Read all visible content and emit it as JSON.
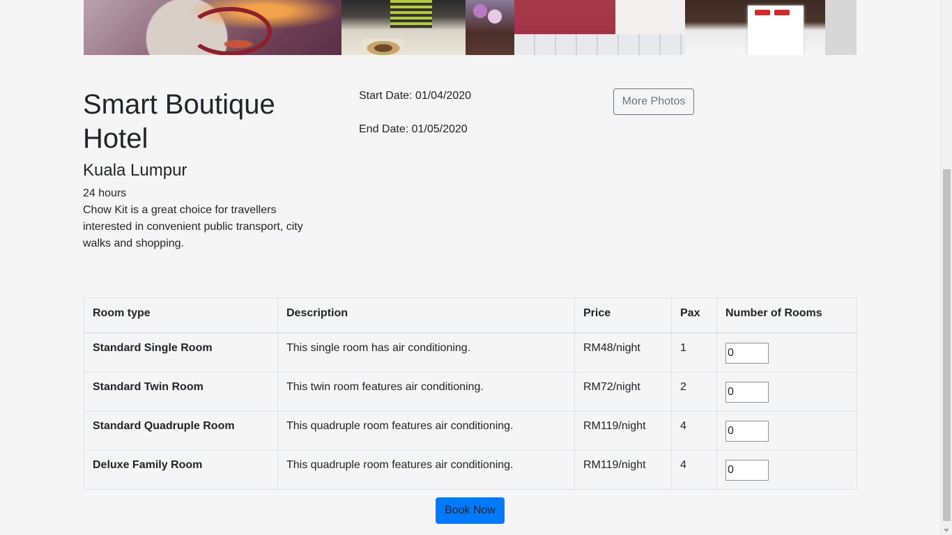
{
  "hotel": {
    "name": "Smart Boutique Hotel",
    "city": "Kuala Lumpur",
    "hours": "24 hours",
    "description": "Chow Kit is a great choice for travellers interested in convenient public transport, city walks and shopping."
  },
  "dates": {
    "start": "Start Date: 01/04/2020",
    "end": "End Date: 01/05/2020"
  },
  "buttons": {
    "more_photos": "More Photos",
    "book_now": "Book Now"
  },
  "table": {
    "headers": [
      "Room type",
      "Description",
      "Price",
      "Pax",
      "Number of Rooms"
    ],
    "rows": [
      {
        "type": "Standard Single Room",
        "description": "This single room has air conditioning.",
        "price": "RM48/night",
        "pax": "1",
        "rooms": "0"
      },
      {
        "type": "Standard Twin Room",
        "description": "This twin room features air conditioning.",
        "price": "RM72/night",
        "pax": "2",
        "rooms": "0"
      },
      {
        "type": "Standard Quadruple Room",
        "description": "This quadruple room features air conditioning.",
        "price": "RM119/night",
        "pax": "4",
        "rooms": "0"
      },
      {
        "type": "Deluxe Family Room",
        "description": "This quadruple room features air conditioning.",
        "price": "RM119/night",
        "pax": "4",
        "rooms": "0"
      }
    ]
  },
  "colors": {
    "primary_button": "#007bff",
    "secondary_outline": "#6c757d",
    "page_background": "#f5f5f5"
  }
}
